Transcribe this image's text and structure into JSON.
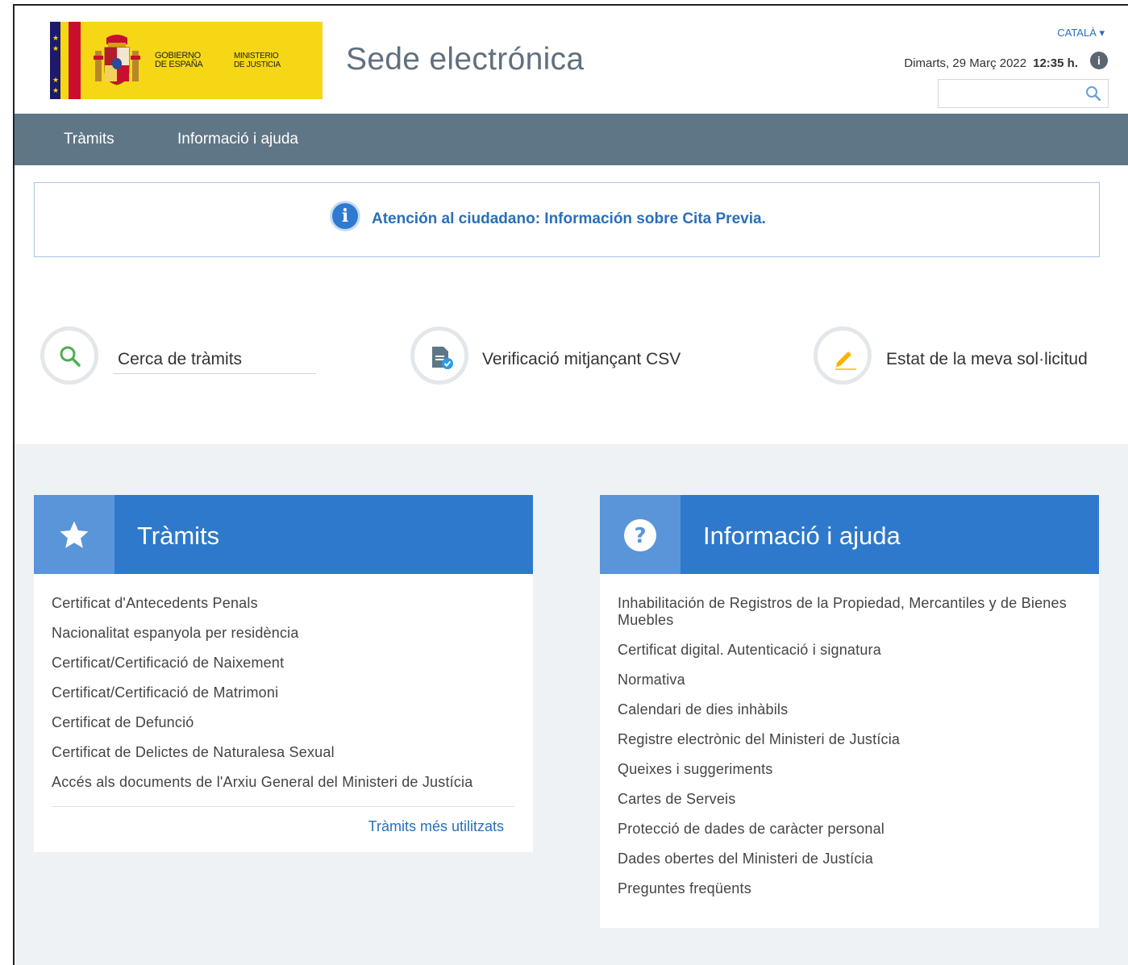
{
  "header": {
    "logo": {
      "gov_line1": "GOBIERNO",
      "gov_line2": "DE ESPAÑA",
      "min_line1": "MINISTERIO",
      "min_line2": "DE JUSTICIA"
    },
    "site_title": "Sede electrónica",
    "language": "CATALÀ ▾",
    "date": "Dimarts, 29 Març 2022",
    "time": "12:35 h.",
    "info_glyph": "i",
    "search_placeholder": ""
  },
  "nav": {
    "items": [
      {
        "label": "Tràmits"
      },
      {
        "label": "Informació i ajuda"
      }
    ]
  },
  "notice": {
    "icon": "info-icon",
    "text": "Atención al ciudadano: Información sobre Cita Previa."
  },
  "quick_access": {
    "search_label": "Cerca de tràmits",
    "csv_label": "Verificació mitjançant CSV",
    "status_label": "Estat de la meva sol·licitud"
  },
  "panels": {
    "tramits": {
      "title": "Tràmits",
      "icon": "star-icon",
      "items": [
        "Certificat d'Antecedents Penals",
        "Nacionalitat espanyola per residència",
        "Certificat/Certificació de Naixement",
        "Certificat/Certificació de Matrimoni",
        "Certificat de Defunció",
        "Certificat de Delictes de Naturalesa Sexual",
        "Accés als documents de l'Arxiu General del Ministeri de Justícia"
      ],
      "more_link": "Tràmits més utilitzats"
    },
    "info": {
      "title": "Informació i ajuda",
      "icon": "question-icon",
      "items": [
        "Inhabilitación de Registros de la Propiedad, Mercantiles y de Bienes Muebles",
        "Certificat digital. Autenticació i signatura",
        "Normativa",
        "Calendari de dies inhàbils",
        "Registre electrònic del Ministeri de Justícia",
        "Queixes i suggeriments",
        "Cartes de Serveis",
        "Protecció de dades de caràcter personal",
        "Dades obertes del Ministeri de Justícia",
        "Preguntes freqüents"
      ]
    }
  },
  "colors": {
    "nav_bg": "#5f7686",
    "panel_header": "#2e79cb",
    "link": "#2a6fb8",
    "logo_yellow": "#f5d716"
  }
}
